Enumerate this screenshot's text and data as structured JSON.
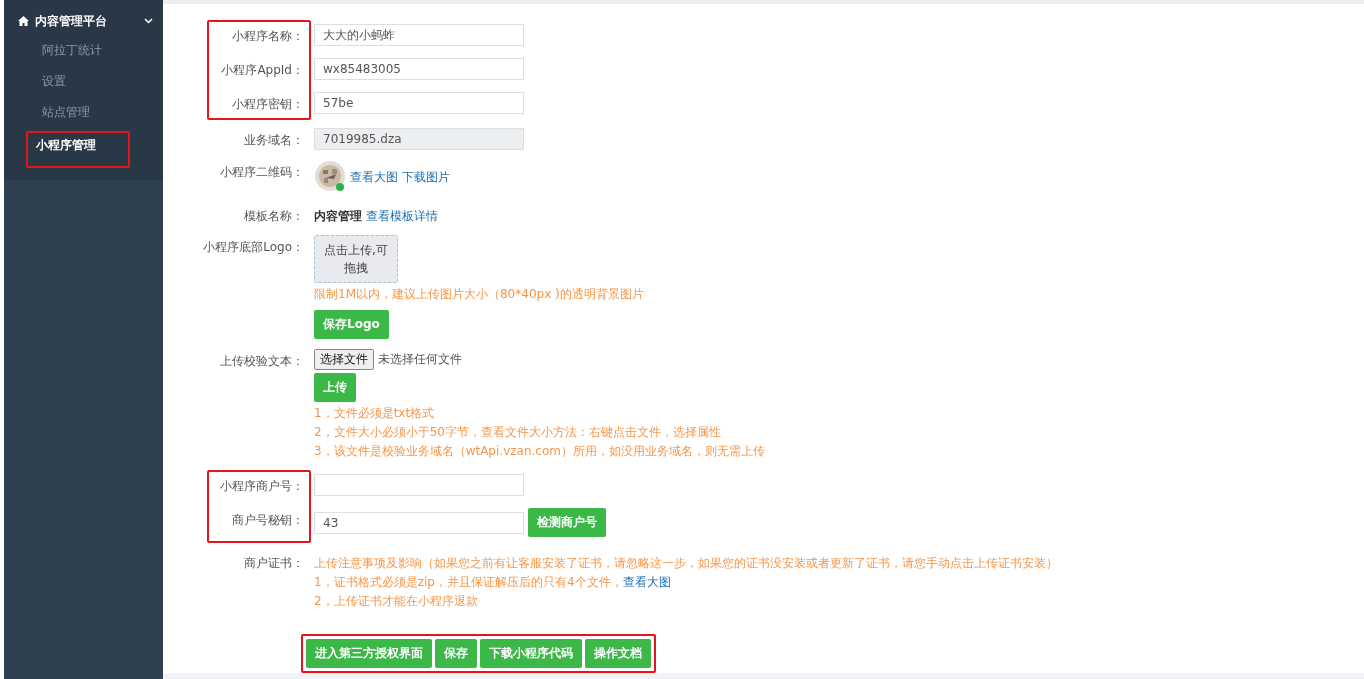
{
  "sidebar": {
    "title": "内容管理平台",
    "expanded": true,
    "items": [
      {
        "label": "阿拉丁统计",
        "selected": false,
        "highlighted": false
      },
      {
        "label": "设置",
        "selected": false,
        "highlighted": false
      },
      {
        "label": "站点管理",
        "selected": false,
        "highlighted": false
      },
      {
        "label": "小程序管理",
        "selected": true,
        "highlighted": true
      }
    ]
  },
  "form": {
    "sections": [
      {
        "highlighted": true,
        "rows": [
          {
            "kind": "input",
            "label": "小程序名称：",
            "value": "大大的小蚂蚱"
          },
          {
            "kind": "input",
            "label": "小程序AppId：",
            "value": "wx85483005"
          },
          {
            "kind": "input",
            "label": "小程序密钥：",
            "value": "57be"
          }
        ]
      },
      {
        "rows": [
          {
            "kind": "readonly",
            "label": "业务域名：",
            "value": "7019985.dza"
          },
          {
            "kind": "qrcode",
            "label": "小程序二维码：",
            "links": [
              "查看大图",
              "下载图片"
            ]
          },
          {
            "kind": "template",
            "label": "模板名称：",
            "value": "内容管理",
            "link": "查看模板详情"
          },
          {
            "kind": "logo",
            "label": "小程序底部Logo：",
            "dropzone": "点击上传,可拖拽",
            "hint": "限制1M以内，建议上传图片大小（80*40px )的透明背景图片",
            "button": "保存Logo"
          },
          {
            "kind": "file",
            "label": "上传校验文本：",
            "choose": "选择文件",
            "status": "未选择任何文件",
            "button": "上传",
            "notes": [
              "1，文件必须是txt格式",
              "2，文件大小必须小于50字节，查看文件大小方法：右键点击文件，选择属性",
              "3，该文件是校验业务域名（wtApi.vzan.com）所用，如没用业务域名，则无需上传"
            ]
          }
        ]
      },
      {
        "highlighted": true,
        "rows": [
          {
            "kind": "input",
            "label": "小程序商户号："
          },
          {
            "kind": "input",
            "label": "商户号秘钥：",
            "value": "43",
            "button": "检测商户号"
          }
        ]
      },
      {
        "rows": [
          {
            "kind": "cert",
            "label": "商户证书：",
            "notes": [
              "上传注意事项及影响（如果您之前有让客服安装了证书，请忽略这一步，如果您的证书没安装或者更新了证书，请您手动点击上传证书安装）",
              "1，证书格式必须是zip，并且保证解压后的只有4个文件，",
              "2，上传证书才能在小程序退款"
            ],
            "link": "查看大图"
          }
        ]
      }
    ]
  },
  "actions": {
    "highlighted": true,
    "buttons": [
      "进入第三方授权界面",
      "保存",
      "下载小程序代码",
      "操作文档"
    ]
  }
}
